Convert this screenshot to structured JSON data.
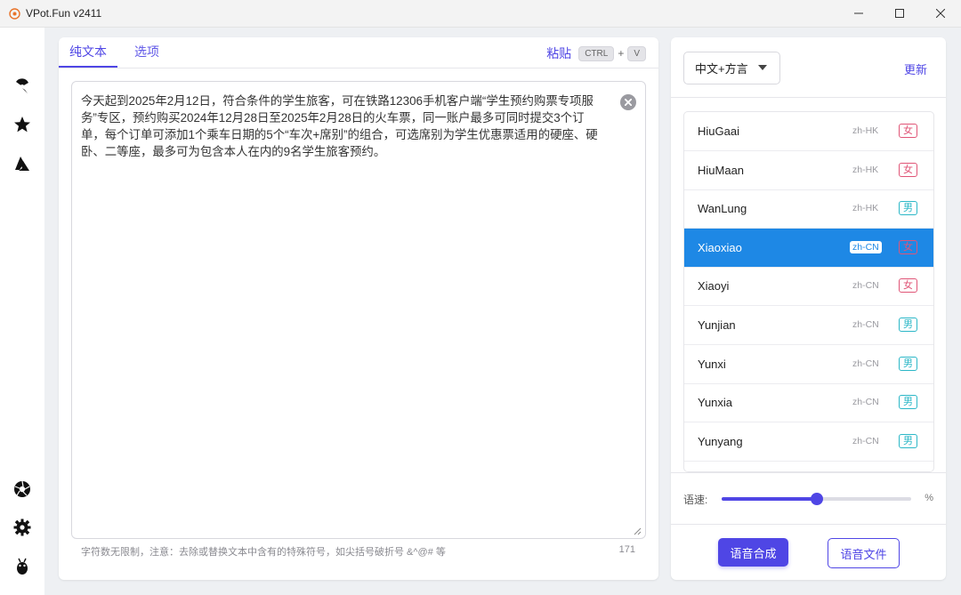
{
  "window": {
    "title": "VPot.Fun v2411",
    "brand_color": "#e8742b"
  },
  "sidebar": {
    "items": [
      {
        "icon": "edge-browser-icon"
      },
      {
        "icon": "star-icon"
      },
      {
        "icon": "azure-icon"
      },
      {
        "icon": "aperture-icon"
      },
      {
        "icon": "gear-icon"
      },
      {
        "icon": "bug-icon"
      }
    ]
  },
  "editor": {
    "tabs": [
      {
        "label": "纯文本",
        "active": true
      },
      {
        "label": "选项",
        "active": false
      }
    ],
    "paste_label": "粘贴",
    "shortcut_keys": [
      "CTRL",
      "V"
    ],
    "shortcut_plus": "+",
    "text": "今天起到2025年2月12日，符合条件的学生旅客，可在铁路12306手机客户端“学生预约购票专项服务”专区，预约购买2024年12月28日至2025年2月28日的火车票，同一账户最多可同时提交3个订单，每个订单可添加1个乘车日期的5个“车次+席别”的组合，可选席别为学生优惠票适用的硬座、硬卧、二等座，最多可为包含本人在内的9名学生旅客预约。",
    "hint": "字符数无限制，注意：去除或替换文本中含有的特殊符号，如尖括号破折号 &^@# 等",
    "char_count": "171"
  },
  "voice_panel": {
    "language_select": "中文+方言",
    "update_label": "更新",
    "voices": [
      {
        "name": "HiuGaai",
        "locale": "zh-HK",
        "gender": "女",
        "gender_type": "female",
        "selected": false
      },
      {
        "name": "HiuMaan",
        "locale": "zh-HK",
        "gender": "女",
        "gender_type": "female",
        "selected": false
      },
      {
        "name": "WanLung",
        "locale": "zh-HK",
        "gender": "男",
        "gender_type": "male",
        "selected": false
      },
      {
        "name": "Xiaoxiao",
        "locale": "zh-CN",
        "gender": "女",
        "gender_type": "female",
        "selected": true
      },
      {
        "name": "Xiaoyi",
        "locale": "zh-CN",
        "gender": "女",
        "gender_type": "female",
        "selected": false
      },
      {
        "name": "Yunjian",
        "locale": "zh-CN",
        "gender": "男",
        "gender_type": "male",
        "selected": false
      },
      {
        "name": "Yunxi",
        "locale": "zh-CN",
        "gender": "男",
        "gender_type": "male",
        "selected": false
      },
      {
        "name": "Yunxia",
        "locale": "zh-CN",
        "gender": "男",
        "gender_type": "male",
        "selected": false
      },
      {
        "name": "Yunyang",
        "locale": "zh-CN",
        "gender": "男",
        "gender_type": "male",
        "selected": false
      }
    ],
    "speed_label": "语速:",
    "speed_value": 0.5,
    "speed_unit": "%",
    "synthesize_button": "语音合成",
    "audio_file_button": "语音文件"
  },
  "colors": {
    "accent": "#4f46e5",
    "selected_row": "#1e88e5",
    "female_tag": "#e05577",
    "male_tag": "#2bb7c7"
  }
}
